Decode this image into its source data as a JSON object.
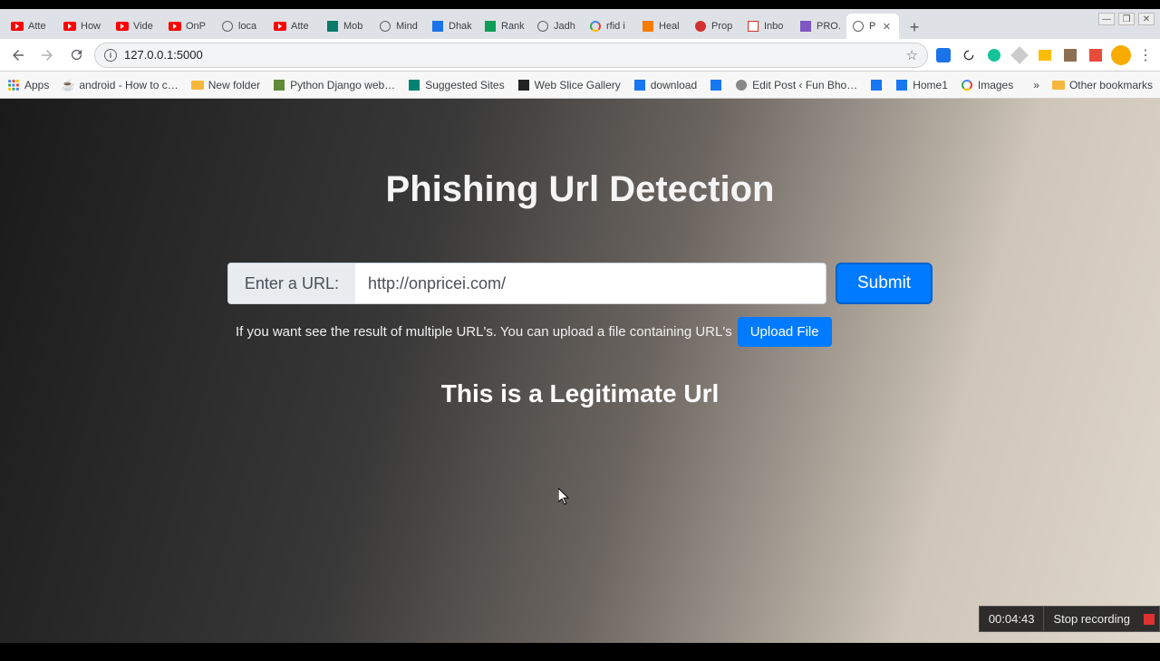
{
  "window_controls": {
    "minimize": "—",
    "maximize": "❐",
    "close": "✕"
  },
  "tabs": [
    {
      "label": "Atte",
      "icon": "youtube"
    },
    {
      "label": "How",
      "icon": "youtube"
    },
    {
      "label": "Vide",
      "icon": "youtube"
    },
    {
      "label": "OnP",
      "icon": "youtube"
    },
    {
      "label": "loca",
      "icon": "globe"
    },
    {
      "label": "Atte",
      "icon": "youtube"
    },
    {
      "label": "Mob",
      "icon": "sq-teal"
    },
    {
      "label": "Mind",
      "icon": "globe"
    },
    {
      "label": "Dhak",
      "icon": "sq-blue"
    },
    {
      "label": "Rank",
      "icon": "sq-green"
    },
    {
      "label": "Jadh",
      "icon": "globe"
    },
    {
      "label": "rfid i",
      "icon": "google"
    },
    {
      "label": "Heal",
      "icon": "sq-orange"
    },
    {
      "label": "Prop",
      "icon": "sq-red"
    },
    {
      "label": "Inbo",
      "icon": "gmail"
    },
    {
      "label": "PRO.",
      "icon": "sq-purple"
    },
    {
      "label": "P",
      "icon": "globe",
      "active": true
    }
  ],
  "new_tab_glyph": "+",
  "nav": {
    "back": "←",
    "forward": "→",
    "reload": "⟳"
  },
  "omnibox": {
    "url": "127.0.0.1:5000",
    "info_glyph": "i",
    "star_glyph": "☆"
  },
  "extensions": [
    "ext1",
    "ext2",
    "ext3",
    "ext4",
    "ext5",
    "ext6",
    "ext7"
  ],
  "bookmarks_bar": {
    "apps": "Apps",
    "items": [
      {
        "label": "android - How to c…",
        "icon": "java"
      },
      {
        "label": "New folder",
        "icon": "folder"
      },
      {
        "label": "Python Django web…",
        "icon": "dj"
      },
      {
        "label": "Suggested Sites",
        "icon": "bing"
      },
      {
        "label": "Web Slice Gallery",
        "icon": "slice"
      },
      {
        "label": "download",
        "icon": "fb"
      },
      {
        "label": "",
        "icon": "fb"
      },
      {
        "label": "Edit Post ‹ Fun Bho…",
        "icon": "spin"
      },
      {
        "label": "",
        "icon": "fb"
      },
      {
        "label": "Home1",
        "icon": "fb"
      },
      {
        "label": "Images",
        "icon": "google"
      }
    ],
    "chevron": "»",
    "other": "Other bookmarks"
  },
  "page": {
    "title": "Phishing Url Detection",
    "input_label": "Enter a URL:",
    "input_value": "http://onpricei.com/",
    "submit_label": "Submit",
    "hint_text": "If you want see the result of multiple URL's. You can upload a file containing URL's",
    "upload_label": "Upload File",
    "result_text": "This is a Legitimate Url"
  },
  "recorder": {
    "time": "00:04:43",
    "stop_label": "Stop recording"
  }
}
